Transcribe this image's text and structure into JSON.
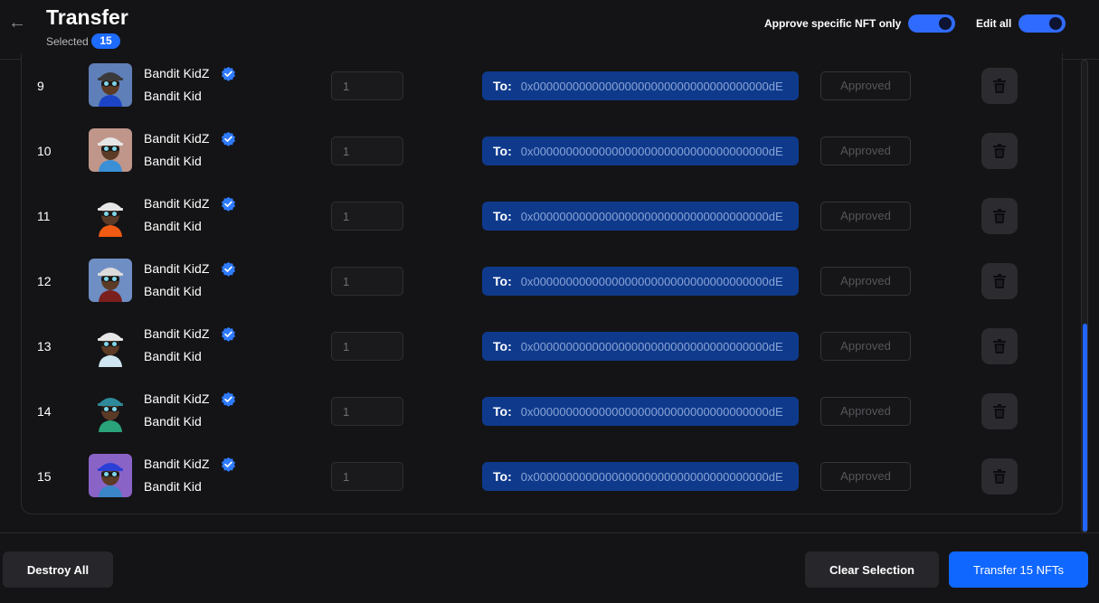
{
  "header": {
    "title": "Transfer",
    "selected_label": "Selected",
    "selected_count": "15",
    "approve_toggle_label": "Approve specific NFT only",
    "approve_toggle_on": true,
    "edit_all_label": "Edit all",
    "edit_all_on": true
  },
  "rows": [
    {
      "index": "9",
      "collection": "Bandit KidZ",
      "name": "Bandit Kid",
      "quantity": "1",
      "to_label": "To:",
      "address": "0x000000000000000000000000000000000000dE",
      "status": "Approved",
      "avatar_bg": "#5f7fb8",
      "avatar_hat": "#3a3a3a",
      "avatar_shirt": "#1c44c6"
    },
    {
      "index": "10",
      "collection": "Bandit KidZ",
      "name": "Bandit Kid",
      "quantity": "1",
      "to_label": "To:",
      "address": "0x000000000000000000000000000000000000dE",
      "status": "Approved",
      "avatar_bg": "#c0968a",
      "avatar_hat": "#e6e6e6",
      "avatar_shirt": "#3a8fd6"
    },
    {
      "index": "11",
      "collection": "Bandit KidZ",
      "name": "Bandit Kid",
      "quantity": "1",
      "to_label": "To:",
      "address": "0x000000000000000000000000000000000000dE",
      "status": "Approved",
      "avatar_bg": "#141416",
      "avatar_hat": "#e6e6e6",
      "avatar_shirt": "#f05a12"
    },
    {
      "index": "12",
      "collection": "Bandit KidZ",
      "name": "Bandit Kid",
      "quantity": "1",
      "to_label": "To:",
      "address": "0x000000000000000000000000000000000000dE",
      "status": "Approved",
      "avatar_bg": "#6f8ec4",
      "avatar_hat": "#dcdcdc",
      "avatar_shirt": "#7a1e1e"
    },
    {
      "index": "13",
      "collection": "Bandit KidZ",
      "name": "Bandit Kid",
      "quantity": "1",
      "to_label": "To:",
      "address": "0x000000000000000000000000000000000000dE",
      "status": "Approved",
      "avatar_bg": "#141416",
      "avatar_hat": "#e6e6e6",
      "avatar_shirt": "#cfe6f2"
    },
    {
      "index": "14",
      "collection": "Bandit KidZ",
      "name": "Bandit Kid",
      "quantity": "1",
      "to_label": "To:",
      "address": "0x000000000000000000000000000000000000dE",
      "status": "Approved",
      "avatar_bg": "#141416",
      "avatar_hat": "#2e8a9a",
      "avatar_shirt": "#2aa37a"
    },
    {
      "index": "15",
      "collection": "Bandit KidZ",
      "name": "Bandit Kid",
      "quantity": "1",
      "to_label": "To:",
      "address": "0x000000000000000000000000000000000000dE",
      "status": "Approved",
      "avatar_bg": "#8a63c7",
      "avatar_hat": "#2a3fd6",
      "avatar_shirt": "#3a86c9"
    }
  ],
  "scrollbar": {
    "position": 0.6
  },
  "footer": {
    "destroy_all_label": "Destroy All",
    "clear_selection_label": "Clear Selection",
    "transfer_label": "Transfer 15 NFTs"
  },
  "colors": {
    "accent": "#1067ff",
    "address_bg": "#0f3a8c",
    "verified": "#2f7bff"
  }
}
